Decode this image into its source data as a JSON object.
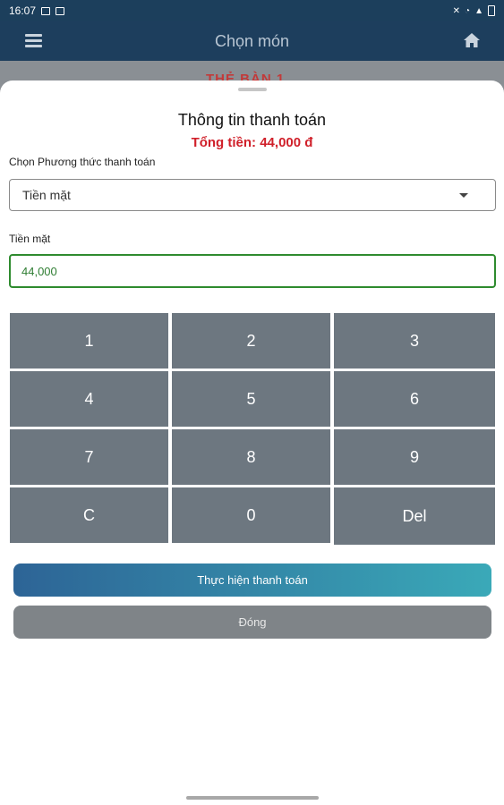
{
  "status_bar": {
    "time": "16:07"
  },
  "app_bar": {
    "title": "Chọn món"
  },
  "background_peek": "THẺ BÀN 1",
  "sheet": {
    "title": "Thông tin thanh toán",
    "total": "Tổng tiền: 44,000 đ",
    "payment_method_label": "Chọn Phương thức thanh toán",
    "payment_method_value": "Tiền mặt",
    "cash_label": "Tiền mặt",
    "cash_value": "44,000"
  },
  "keypad": {
    "keys": [
      "1",
      "2",
      "3",
      "4",
      "5",
      "6",
      "7",
      "8",
      "9",
      "C",
      "0",
      "Del"
    ]
  },
  "buttons": {
    "pay": "Thực hiện thanh toán",
    "close": "Đóng"
  },
  "colors": {
    "app_bar": "#1d3e5d",
    "total_text": "#d0202a",
    "input_border": "#2e8b2e",
    "key_bg": "#6d7780",
    "pay_gradient_start": "#2d6496",
    "pay_gradient_end": "#3aa9b8",
    "close_bg": "#7f8488"
  }
}
